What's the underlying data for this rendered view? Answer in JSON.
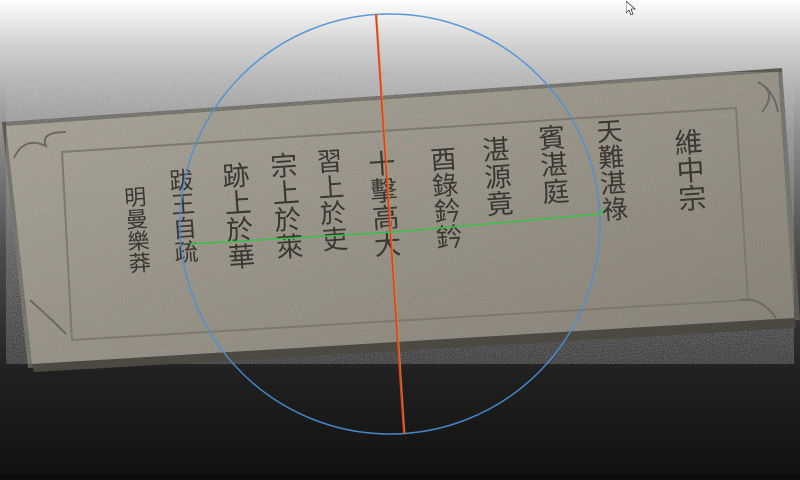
{
  "viewport": {
    "background_top": "#ffffff",
    "background_bottom": "#111111"
  },
  "stele": {
    "stone_color": "#a49f93",
    "stone_shadow": "#6f6b62",
    "inscription_color": "#3a3631",
    "columns": [
      "維中宗",
      "天難湛祿",
      "賓湛庭",
      "湛源竟",
      "酉錄鈐鈐",
      "十擊高大",
      "習上於吏",
      "宗上於萊",
      "跡上於華",
      "跋王自疏",
      "明曼樂莽"
    ]
  },
  "gizmo": {
    "rotation_ring_color": "#4a8fd6",
    "x_axis_color": "#e53b2a",
    "y_axis_color": "#c9a020",
    "z_axis_color": "#35c24a"
  },
  "cursor": {
    "icon": "mouse-pointer-icon",
    "color": "#ffffff"
  }
}
